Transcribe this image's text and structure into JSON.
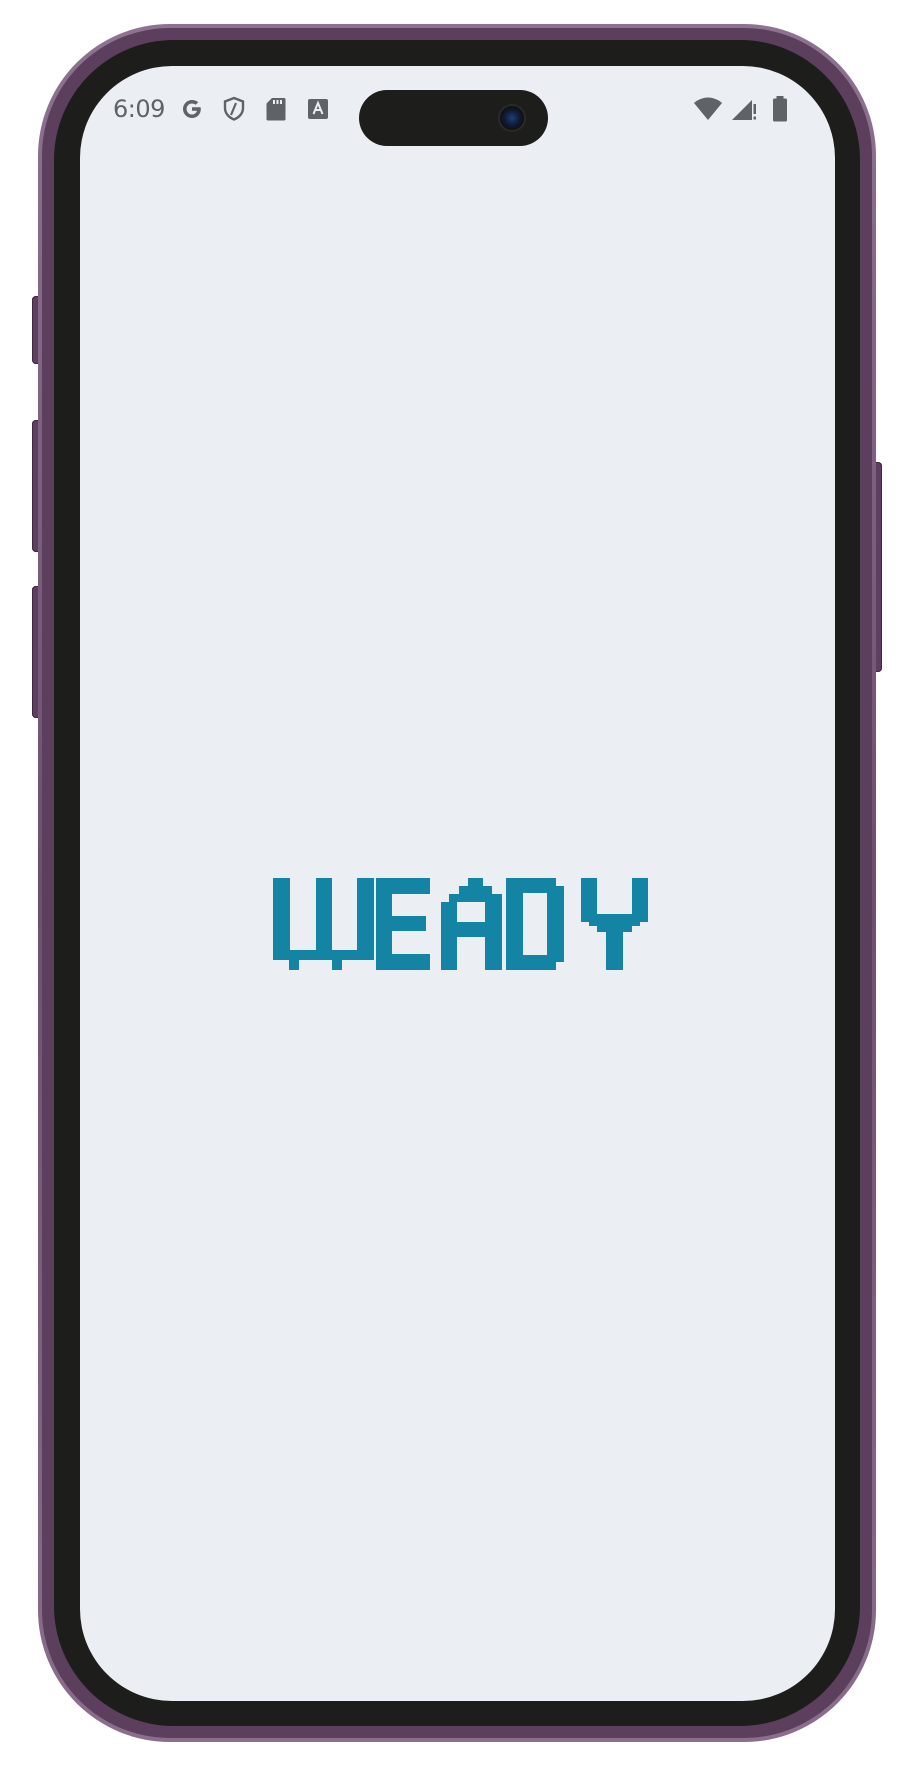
{
  "status_bar": {
    "time": "6:09",
    "left_icons": [
      "google-g-icon",
      "shield-icon",
      "sd-card-icon",
      "autofill-a-icon"
    ],
    "right_icons": [
      "wifi-icon",
      "cellular-signal-no-service-icon",
      "battery-icon"
    ]
  },
  "splash": {
    "logo_text": "WEADY",
    "logo_color": "#1384a3"
  },
  "device": {
    "frame_color": "#6e4f70",
    "screen_background": "#ebeff3"
  }
}
